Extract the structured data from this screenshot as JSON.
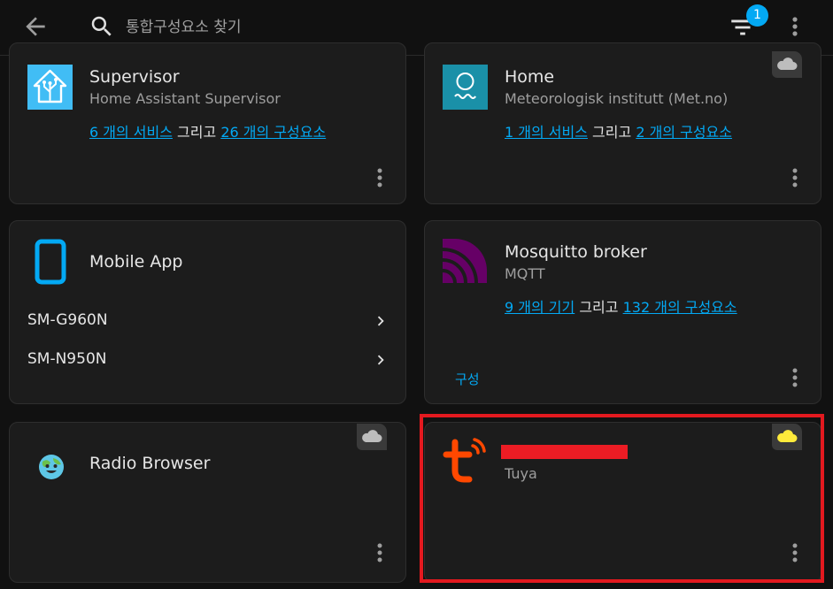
{
  "header": {
    "search_placeholder": "통합구성요소 찾기",
    "filter_badge": "1"
  },
  "cards": {
    "supervisor": {
      "title": "Supervisor",
      "subtitle": "Home Assistant Supervisor",
      "link_services": "6 개의 서비스",
      "conjunction": "그리고",
      "link_entities": "26 개의 구성요소"
    },
    "home": {
      "title": "Home",
      "subtitle": "Meteorologisk institutt (Met.no)",
      "link_services": "1 개의 서비스",
      "conjunction": "그리고",
      "link_entities": "2 개의 구성요소"
    },
    "mobile_app": {
      "title": "Mobile App",
      "devices": [
        "SM-G960N",
        "SM-N950N"
      ]
    },
    "mosquitto": {
      "title": "Mosquitto broker",
      "subtitle": "MQTT",
      "link_devices": "9 개의 기기",
      "conjunction": "그리고",
      "link_entities": "132 개의 구성요소",
      "configure": "구성"
    },
    "radio_browser": {
      "title": "Radio Browser"
    },
    "tuya": {
      "subtitle": "Tuya"
    }
  },
  "colors": {
    "accent": "#03a9f4",
    "highlight": "#e3191f",
    "tuya": "#ff4800",
    "mqtt": "#660066",
    "cloud_active": "#ffeb3b"
  }
}
